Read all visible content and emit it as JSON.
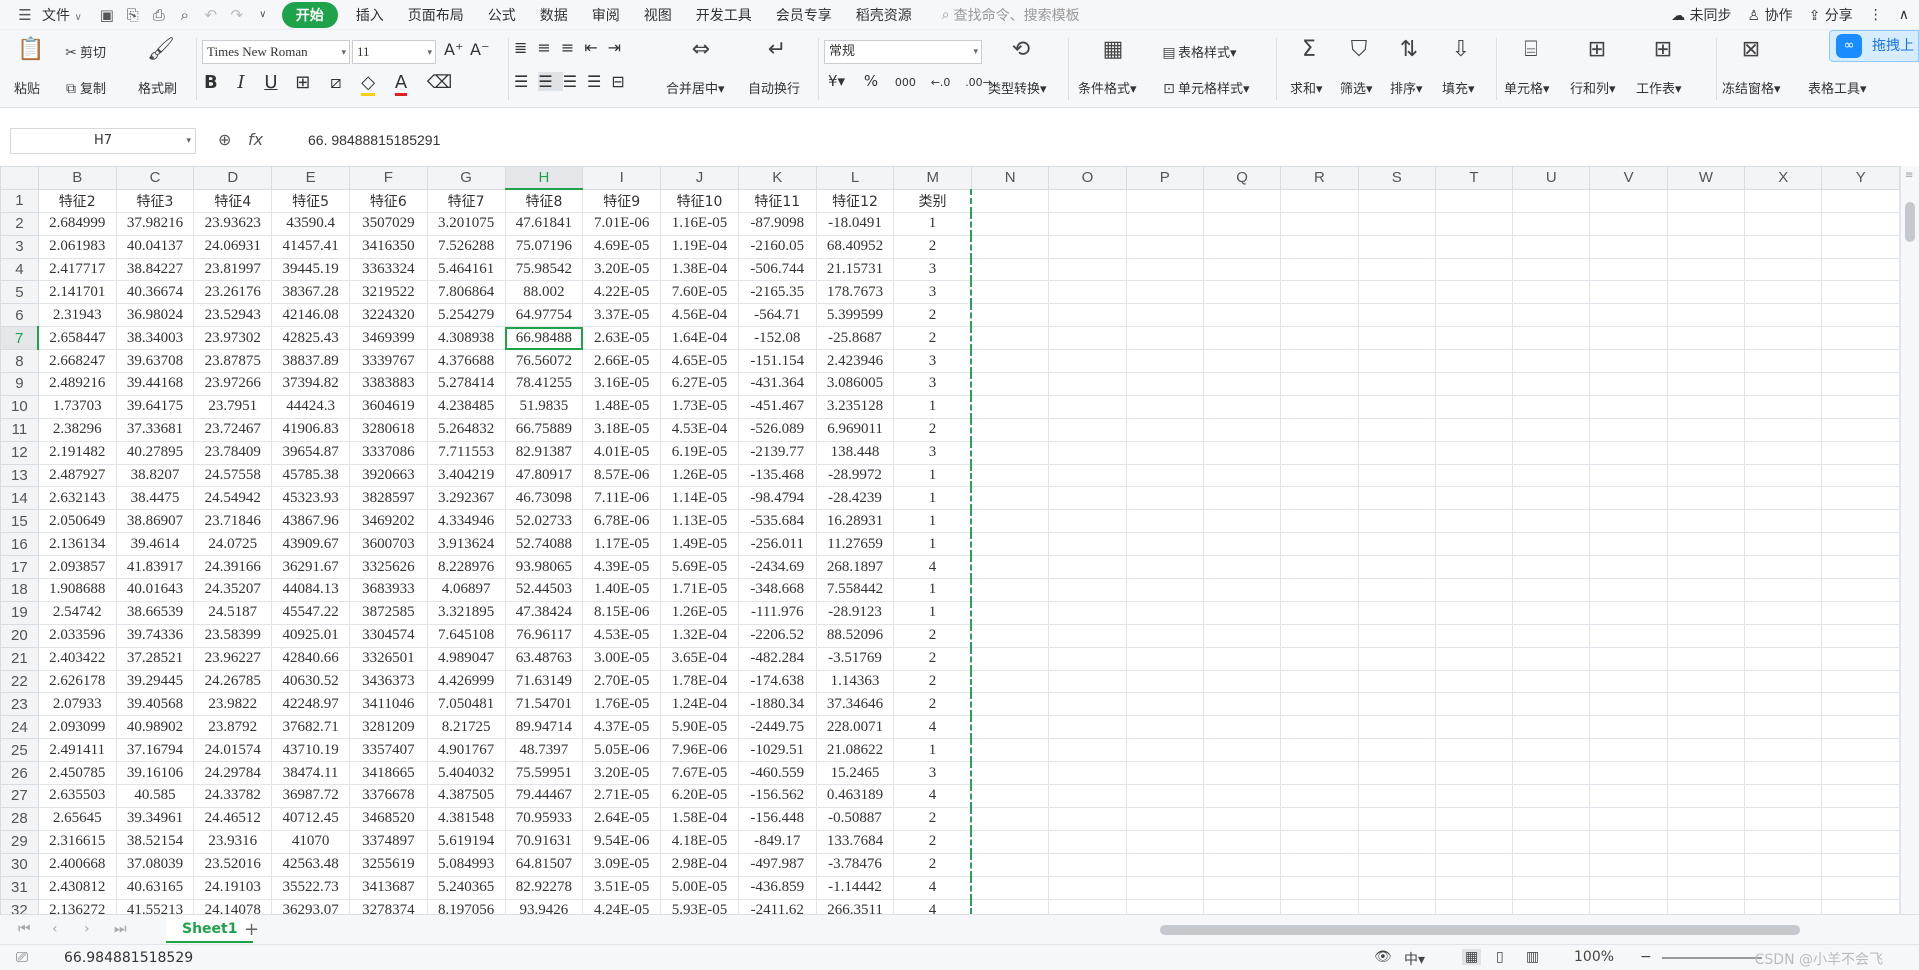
{
  "menubar": {
    "file": "文件",
    "tabs": [
      "开始",
      "插入",
      "页面布局",
      "公式",
      "数据",
      "审阅",
      "视图",
      "开发工具",
      "会员专享",
      "稻壳资源"
    ],
    "search_placeholder": "查找命令、搜索模板",
    "sync": "未同步",
    "collab": "协作",
    "share": "分享"
  },
  "ribbon": {
    "paste": "粘贴",
    "cut": "剪切",
    "copy": "复制",
    "format_painter": "格式刷",
    "font_name": "Times New Roman",
    "font_size": "11",
    "merge_center": "合并居中",
    "wrap_text": "自动换行",
    "number_format": "常规",
    "type_convert": "类型转换",
    "conditional_format": "条件格式",
    "table_style": "表格样式",
    "cell_style": "单元格样式",
    "sum": "求和",
    "filter": "筛选",
    "sort": "排序",
    "fill": "填充",
    "cells": "单元格",
    "rows_cols": "行和列",
    "worksheet": "工作表",
    "freeze": "冻结窗格",
    "table_tools": "表格工具",
    "float_label": "拖拽上"
  },
  "formula": {
    "cell_ref": "H7",
    "value": "66. 98488815185291"
  },
  "columns": [
    "B",
    "C",
    "D",
    "E",
    "F",
    "G",
    "H",
    "I",
    "J",
    "K",
    "L",
    "M",
    "N",
    "O",
    "P",
    "Q",
    "R",
    "S",
    "T",
    "U",
    "V",
    "W",
    "X",
    "Y"
  ],
  "header_row": [
    "特征2",
    "特征3",
    "特征4",
    "特征5",
    "特征6",
    "特征7",
    "特征8",
    "特征9",
    "特征10",
    "特征11",
    "特征12",
    "类别"
  ],
  "rows": [
    [
      "2.684999",
      "37.98216",
      "23.93623",
      "43590.4",
      "3507029",
      "3.201075",
      "47.61841",
      "7.01E-06",
      "1.16E-05",
      "-87.9098",
      "-18.0491",
      "1"
    ],
    [
      "2.061983",
      "40.04137",
      "24.06931",
      "41457.41",
      "3416350",
      "7.526288",
      "75.07196",
      "4.69E-05",
      "1.19E-04",
      "-2160.05",
      "68.40952",
      "2"
    ],
    [
      "2.417717",
      "38.84227",
      "23.81997",
      "39445.19",
      "3363324",
      "5.464161",
      "75.98542",
      "3.20E-05",
      "1.38E-04",
      "-506.744",
      "21.15731",
      "3"
    ],
    [
      "2.141701",
      "40.36674",
      "23.26176",
      "38367.28",
      "3219522",
      "7.806864",
      "88.002",
      "4.22E-05",
      "7.60E-05",
      "-2165.35",
      "178.7673",
      "3"
    ],
    [
      "2.31943",
      "36.98024",
      "23.52943",
      "42146.08",
      "3224320",
      "5.254279",
      "64.97754",
      "3.37E-05",
      "4.56E-04",
      "-564.71",
      "5.399599",
      "2"
    ],
    [
      "2.658447",
      "38.34003",
      "23.97302",
      "42825.43",
      "3469399",
      "4.308938",
      "66.98488",
      "2.63E-05",
      "1.64E-04",
      "-152.08",
      "-25.8687",
      "2"
    ],
    [
      "2.668247",
      "39.63708",
      "23.87875",
      "38837.89",
      "3339767",
      "4.376688",
      "76.56072",
      "2.66E-05",
      "4.65E-05",
      "-151.154",
      "2.423946",
      "3"
    ],
    [
      "2.489216",
      "39.44168",
      "23.97266",
      "37394.82",
      "3383883",
      "5.278414",
      "78.41255",
      "3.16E-05",
      "6.27E-05",
      "-431.364",
      "3.086005",
      "3"
    ],
    [
      "1.73703",
      "39.64175",
      "23.7951",
      "44424.3",
      "3604619",
      "4.238485",
      "51.9835",
      "1.48E-05",
      "1.73E-05",
      "-451.467",
      "3.235128",
      "1"
    ],
    [
      "2.38296",
      "37.33681",
      "23.72467",
      "41906.83",
      "3280618",
      "5.264832",
      "66.75889",
      "3.18E-05",
      "4.53E-04",
      "-526.089",
      "6.969011",
      "2"
    ],
    [
      "2.191482",
      "40.27895",
      "23.78409",
      "39654.87",
      "3337086",
      "7.711553",
      "82.91387",
      "4.01E-05",
      "6.19E-05",
      "-2139.77",
      "138.448",
      "3"
    ],
    [
      "2.487927",
      "38.8207",
      "24.57558",
      "45785.38",
      "3920663",
      "3.404219",
      "47.80917",
      "8.57E-06",
      "1.26E-05",
      "-135.468",
      "-28.9972",
      "1"
    ],
    [
      "2.632143",
      "38.4475",
      "24.54942",
      "45323.93",
      "3828597",
      "3.292367",
      "46.73098",
      "7.11E-06",
      "1.14E-05",
      "-98.4794",
      "-28.4239",
      "1"
    ],
    [
      "2.050649",
      "38.86907",
      "23.71846",
      "43867.96",
      "3469202",
      "4.334946",
      "52.02733",
      "6.78E-06",
      "1.13E-05",
      "-535.684",
      "16.28931",
      "1"
    ],
    [
      "2.136134",
      "39.4614",
      "24.0725",
      "43909.67",
      "3600703",
      "3.913624",
      "52.74088",
      "1.17E-05",
      "1.49E-05",
      "-256.011",
      "11.27659",
      "1"
    ],
    [
      "2.093857",
      "41.83917",
      "24.39166",
      "36291.67",
      "3325626",
      "8.228976",
      "93.98065",
      "4.39E-05",
      "5.69E-05",
      "-2434.69",
      "268.1897",
      "4"
    ],
    [
      "1.908688",
      "40.01643",
      "24.35207",
      "44084.13",
      "3683933",
      "4.06897",
      "52.44503",
      "1.40E-05",
      "1.71E-05",
      "-348.668",
      "7.558442",
      "1"
    ],
    [
      "2.54742",
      "38.66539",
      "24.5187",
      "45547.22",
      "3872585",
      "3.321895",
      "47.38424",
      "8.15E-06",
      "1.26E-05",
      "-111.976",
      "-28.9123",
      "1"
    ],
    [
      "2.033596",
      "39.74336",
      "23.58399",
      "40925.01",
      "3304574",
      "7.645108",
      "76.96117",
      "4.53E-05",
      "1.32E-04",
      "-2206.52",
      "88.52096",
      "2"
    ],
    [
      "2.403422",
      "37.28521",
      "23.96227",
      "42840.66",
      "3326501",
      "4.989047",
      "63.48763",
      "3.00E-05",
      "3.65E-04",
      "-482.284",
      "-3.51769",
      "2"
    ],
    [
      "2.626178",
      "39.29445",
      "24.26785",
      "40630.52",
      "3436373",
      "4.426999",
      "71.63149",
      "2.70E-05",
      "1.78E-04",
      "-174.638",
      "1.14363",
      "2"
    ],
    [
      "2.07933",
      "39.40568",
      "23.9822",
      "42248.97",
      "3411046",
      "7.050481",
      "71.54701",
      "1.76E-05",
      "1.24E-04",
      "-1880.34",
      "37.34646",
      "2"
    ],
    [
      "2.093099",
      "40.98902",
      "23.8792",
      "37682.71",
      "3281209",
      "8.21725",
      "89.94714",
      "4.37E-05",
      "5.90E-05",
      "-2449.75",
      "228.0071",
      "4"
    ],
    [
      "2.491411",
      "37.16794",
      "24.01574",
      "43710.19",
      "3357407",
      "4.901767",
      "48.7397",
      "5.05E-06",
      "7.96E-06",
      "-1029.51",
      "21.08622",
      "1"
    ],
    [
      "2.450785",
      "39.16106",
      "24.29784",
      "38474.11",
      "3418665",
      "5.404032",
      "75.59951",
      "3.20E-05",
      "7.67E-05",
      "-460.559",
      "15.2465",
      "3"
    ],
    [
      "2.635503",
      "40.585",
      "24.33782",
      "36987.72",
      "3376678",
      "4.387505",
      "79.44467",
      "2.71E-05",
      "6.20E-05",
      "-156.562",
      "0.463189",
      "4"
    ],
    [
      "2.65645",
      "39.34961",
      "24.46512",
      "40712.45",
      "3468520",
      "4.381548",
      "70.95933",
      "2.64E-05",
      "1.58E-04",
      "-156.448",
      "-0.50887",
      "2"
    ],
    [
      "2.316615",
      "38.52154",
      "23.9316",
      "41070",
      "3374897",
      "5.619194",
      "70.91631",
      "9.54E-06",
      "4.18E-05",
      "-849.17",
      "133.7684",
      "2"
    ],
    [
      "2.400668",
      "37.08039",
      "23.52016",
      "42563.48",
      "3255619",
      "5.084993",
      "64.81507",
      "3.09E-05",
      "2.98E-04",
      "-497.987",
      "-3.78476",
      "2"
    ],
    [
      "2.430812",
      "40.63165",
      "24.19103",
      "35522.73",
      "3413687",
      "5.240365",
      "82.92278",
      "3.51E-05",
      "5.00E-05",
      "-436.859",
      "-1.14442",
      "4"
    ],
    [
      "2.136272",
      "41.55213",
      "24.14078",
      "36293.07",
      "3278374",
      "8.197056",
      "93.9426",
      "4.24E-05",
      "5.93E-05",
      "-2411.62",
      "266.3511",
      "4"
    ]
  ],
  "selected": {
    "row": 7,
    "col": "H"
  },
  "sheet_tab": "Sheet1",
  "status": {
    "value": "66.984881518529",
    "zoom": "100%",
    "watermark": "CSDN @小羊不会飞"
  }
}
